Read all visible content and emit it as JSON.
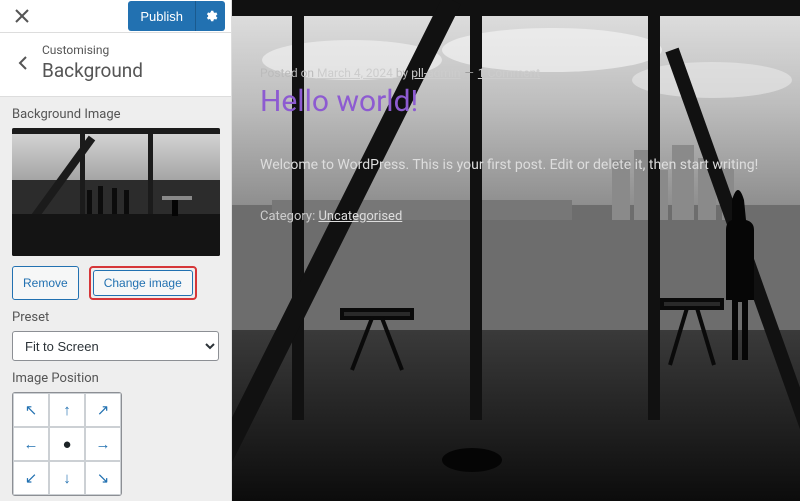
{
  "header": {
    "publish_label": "Publish"
  },
  "section": {
    "crumb": "Customising",
    "title": "Background"
  },
  "bg_image": {
    "label": "Background Image",
    "remove_label": "Remove",
    "change_label": "Change image"
  },
  "preset": {
    "label": "Preset",
    "value": "Fit to Screen"
  },
  "position": {
    "label": "Image Position"
  },
  "post": {
    "meta_prefix": "Posted on ",
    "date": "March 4, 2024",
    "by": " by ",
    "author": "pll-admin",
    "comments": "1 Comment",
    "title": "Hello world!",
    "body": "Welcome to WordPress. This is your first post. Edit or delete it, then start writing!",
    "cat_label": "Category: ",
    "cat_value": "Uncategorised"
  }
}
